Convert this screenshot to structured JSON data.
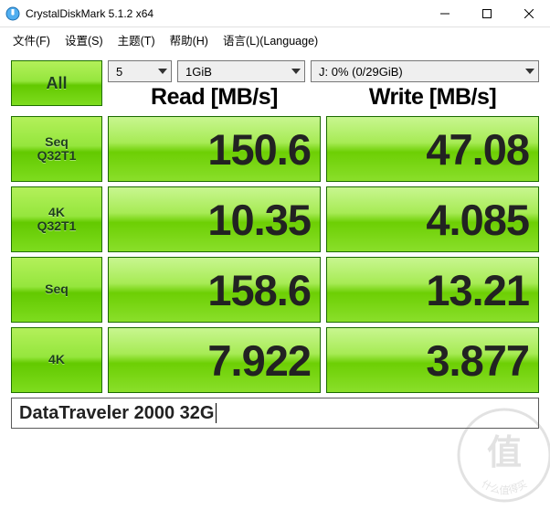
{
  "window": {
    "title": "CrystalDiskMark 5.1.2 x64"
  },
  "menu": {
    "file": "文件(F)",
    "settings": "设置(S)",
    "theme": "主题(T)",
    "help": "帮助(H)",
    "language": "语言(L)(Language)"
  },
  "controls": {
    "all_label": "All",
    "runs_selected": "5",
    "size_selected": "1GiB",
    "drive_selected": "J: 0% (0/29GiB)"
  },
  "headers": {
    "read": "Read [MB/s]",
    "write": "Write [MB/s]"
  },
  "rows": [
    {
      "label": "Seq\nQ32T1",
      "read": "150.6",
      "write": "47.08"
    },
    {
      "label": "4K\nQ32T1",
      "read": "10.35",
      "write": "4.085"
    },
    {
      "label": "Seq",
      "read": "158.6",
      "write": "13.21"
    },
    {
      "label": "4K",
      "read": "7.922",
      "write": "3.877"
    }
  ],
  "footer": {
    "drive_name": "DataTraveler 2000 32G"
  },
  "watermark": {
    "top": "值",
    "side": "什么值得买"
  }
}
